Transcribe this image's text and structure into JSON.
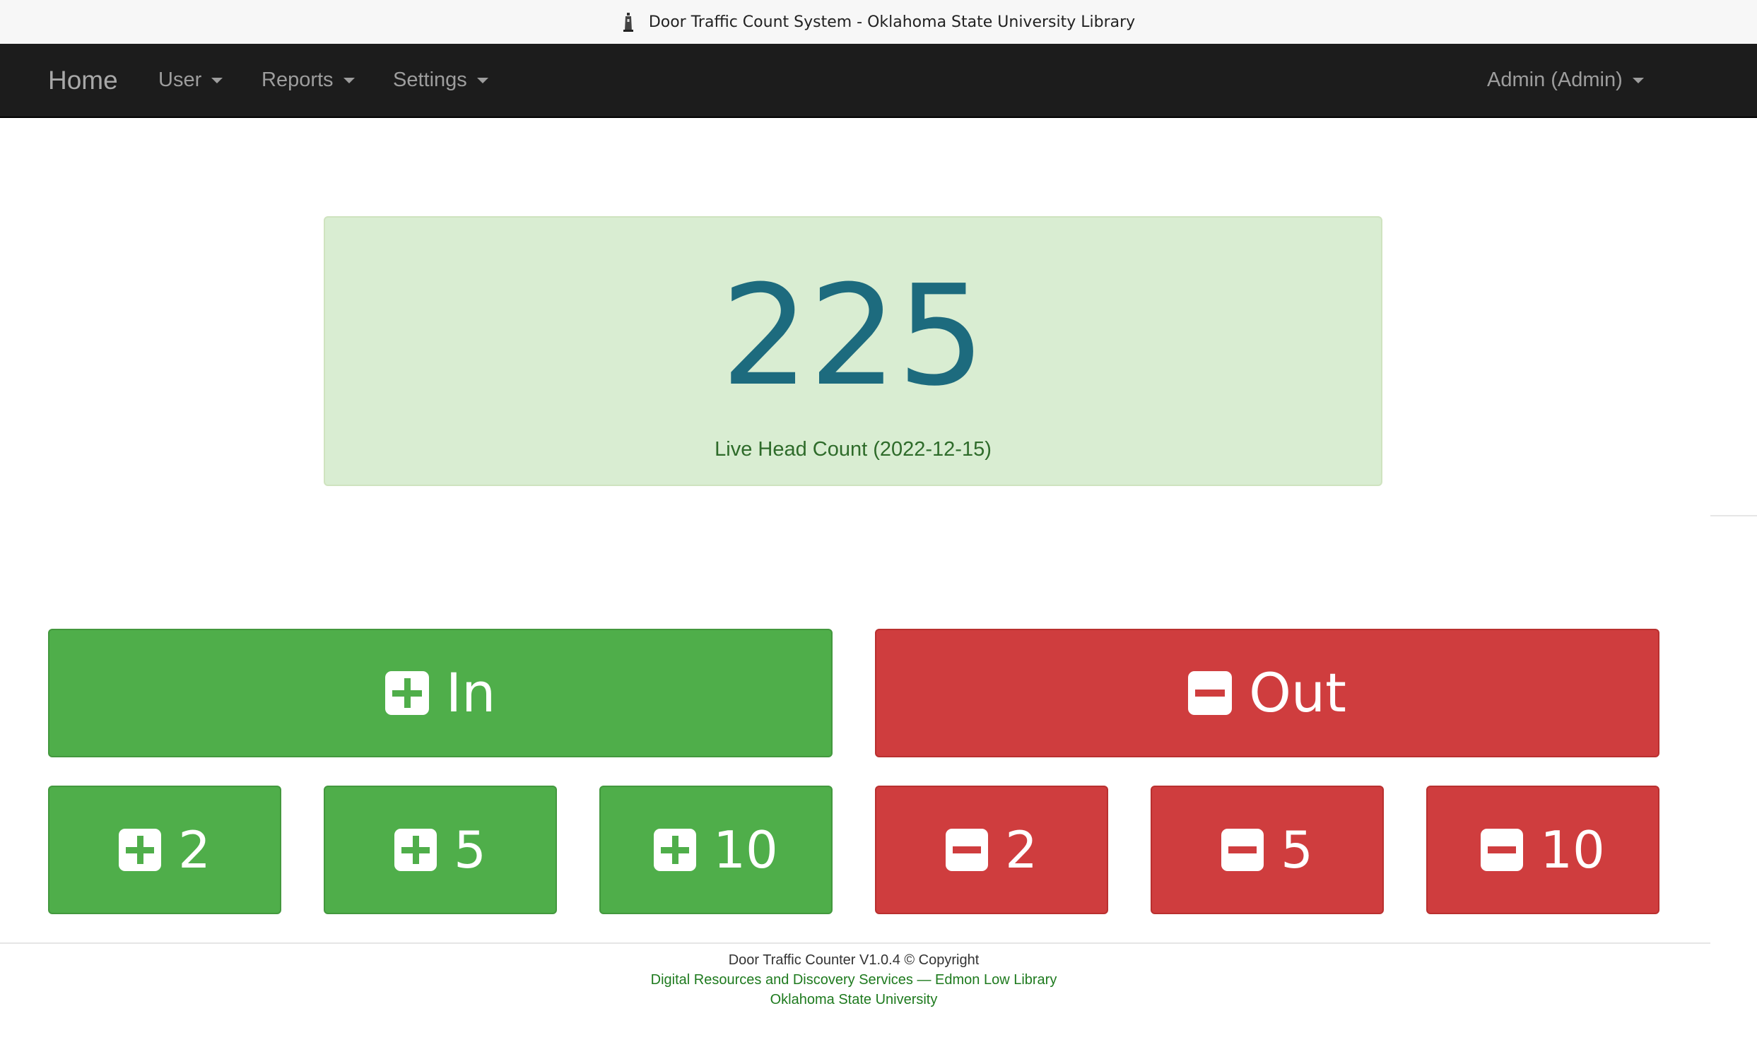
{
  "window": {
    "title": "Door Traffic Count System - Oklahoma State University Library",
    "icon": "tower-icon"
  },
  "nav": {
    "brand": "Home",
    "items": [
      {
        "label": "User"
      },
      {
        "label": "Reports"
      },
      {
        "label": "Settings"
      }
    ],
    "account": "Admin (Admin)"
  },
  "count": {
    "value": "225",
    "label": "Live Head Count (2022-12-15)"
  },
  "actions": {
    "in": {
      "label": "In",
      "icon": "plus-square-icon",
      "color": "#4fae4a"
    },
    "out": {
      "label": "Out",
      "icon": "minus-square-icon",
      "color": "#cf3d3e"
    },
    "add": [
      "2",
      "5",
      "10"
    ],
    "subtract": [
      "2",
      "5",
      "10"
    ]
  },
  "footer": {
    "line1": "Door Traffic Counter V1.0.4 © Copyright",
    "line2": "Digital Resources and Discovery Services — Edmon Low Library",
    "line3": "Oklahoma State University"
  }
}
